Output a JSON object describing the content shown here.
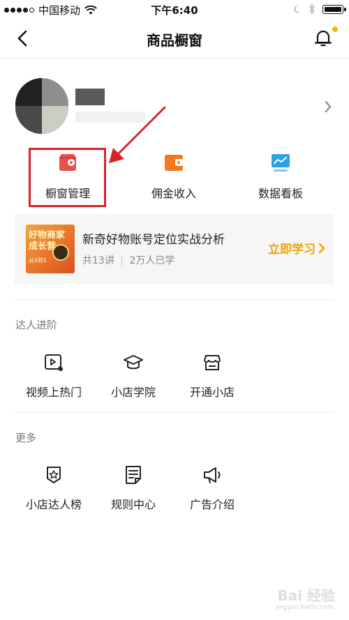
{
  "status_bar": {
    "carrier": "中国移动",
    "time": "下午6:40"
  },
  "navbar": {
    "title": "商品橱窗"
  },
  "quick_entries": [
    {
      "label": "橱窗管理",
      "icon": "shop-settings-icon",
      "color": "#e8504a"
    },
    {
      "label": "佣金收入",
      "icon": "wallet-icon",
      "color": "#f07a20"
    },
    {
      "label": "数据看板",
      "icon": "chart-board-icon",
      "color": "#2aa3e8"
    }
  ],
  "course": {
    "thumb_line1": "好物商家",
    "thumb_line2": "成长营",
    "thumb_line3": "从0到1",
    "title": "新奇好物账号定位实战分析",
    "lessons": "共13讲",
    "learners": "2万人已学",
    "action": "立即学习",
    "accent_color": "#f0a500"
  },
  "sections": [
    {
      "title": "达人进阶",
      "items": [
        {
          "label": "视频上热门",
          "icon": "video-hot-icon"
        },
        {
          "label": "小店学院",
          "icon": "graduation-cap-icon"
        },
        {
          "label": "开通小店",
          "icon": "store-icon"
        }
      ]
    },
    {
      "title": "更多",
      "items": [
        {
          "label": "小店达人榜",
          "icon": "ranking-badge-icon"
        },
        {
          "label": "规则中心",
          "icon": "rules-document-icon"
        },
        {
          "label": "广告介绍",
          "icon": "megaphone-icon"
        }
      ]
    }
  ],
  "watermark": {
    "text": "Bai 经验",
    "sub": "jingyan.baidu.com"
  },
  "colors": {
    "highlight_box": "#d9222a",
    "annotation_arrow": "#d9222a",
    "notification_dot": "#f5b700"
  }
}
